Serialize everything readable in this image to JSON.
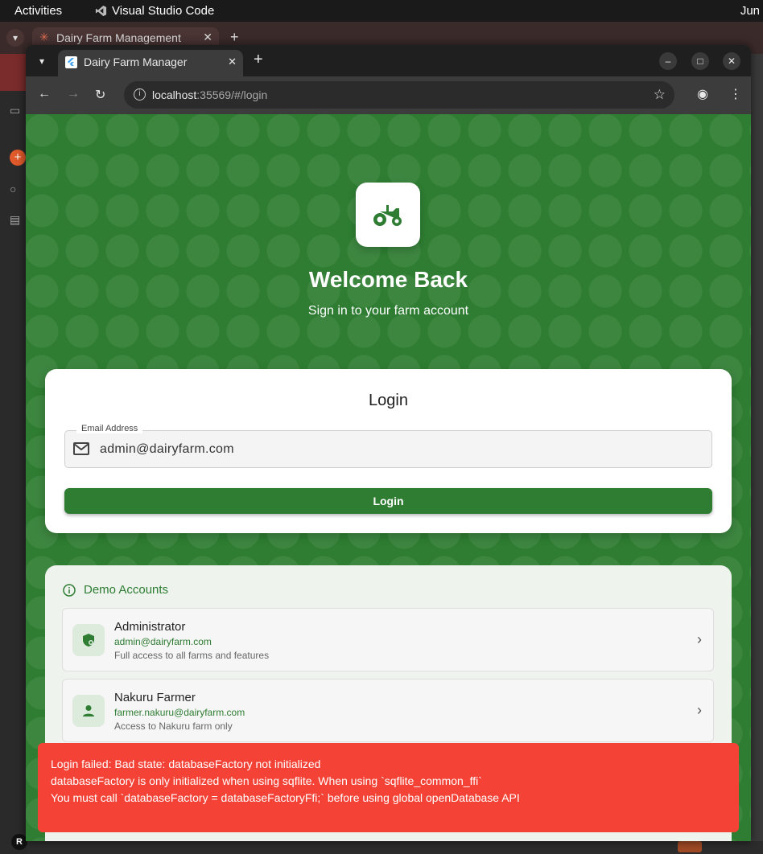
{
  "topbar": {
    "activities": "Activities",
    "app": "Visual Studio Code",
    "clock": "Jun"
  },
  "bg_window": {
    "tab_title": "Dairy Farm Management",
    "user_initial": "R"
  },
  "browser": {
    "tab_title": "Dairy Farm Manager",
    "url_host": "localhost",
    "url_rest": ":35569/#/login"
  },
  "page": {
    "welcome": "Welcome Back",
    "subtitle": "Sign in to your farm account",
    "login": {
      "title": "Login",
      "email_label": "Email Address",
      "email_value": "admin@dairyfarm.com",
      "button": "Login"
    },
    "demo": {
      "heading": "Demo Accounts",
      "accounts": [
        {
          "name": "Administrator",
          "email": "admin@dairyfarm.com",
          "desc": "Full access to all farms and features",
          "icon": "admin-shield-icon"
        },
        {
          "name": "Nakuru Farmer",
          "email": "farmer.nakuru@dairyfarm.com",
          "desc": "Access to Nakuru farm only",
          "icon": "person-icon"
        }
      ]
    },
    "error": {
      "line1": "Login failed: Bad state: databaseFactory not initialized",
      "line2": "databaseFactory is only initialized when using sqflite. When using `sqflite_common_ffi`",
      "line3": "You must call `databaseFactory = databaseFactoryFfi;` before using global openDatabase API"
    }
  },
  "colors": {
    "brand_green": "#2e7d32",
    "error_red": "#f44336"
  }
}
